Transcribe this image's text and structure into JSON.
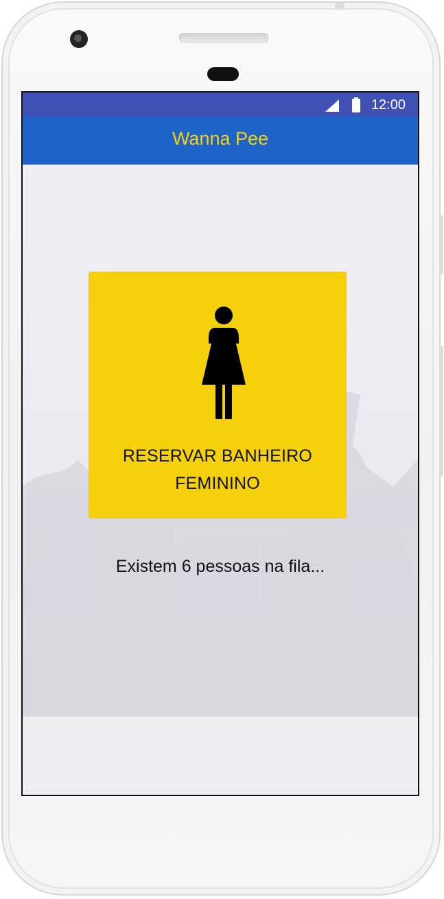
{
  "status_bar": {
    "time": "12:00",
    "icons": [
      "signal-icon",
      "battery-icon"
    ],
    "color": "#3f51b5"
  },
  "app_bar": {
    "title": "Wanna Pee",
    "color": "#1e63c8",
    "title_color": "#f5d10c"
  },
  "main": {
    "reserve_button": {
      "icon": "female-toilet-icon",
      "label_line1": "RESERVAR BANHEIRO",
      "label_line2": "FEMININO",
      "color": "#f5d10c"
    },
    "queue_message": "Existem 6 pessoas na fila..."
  }
}
